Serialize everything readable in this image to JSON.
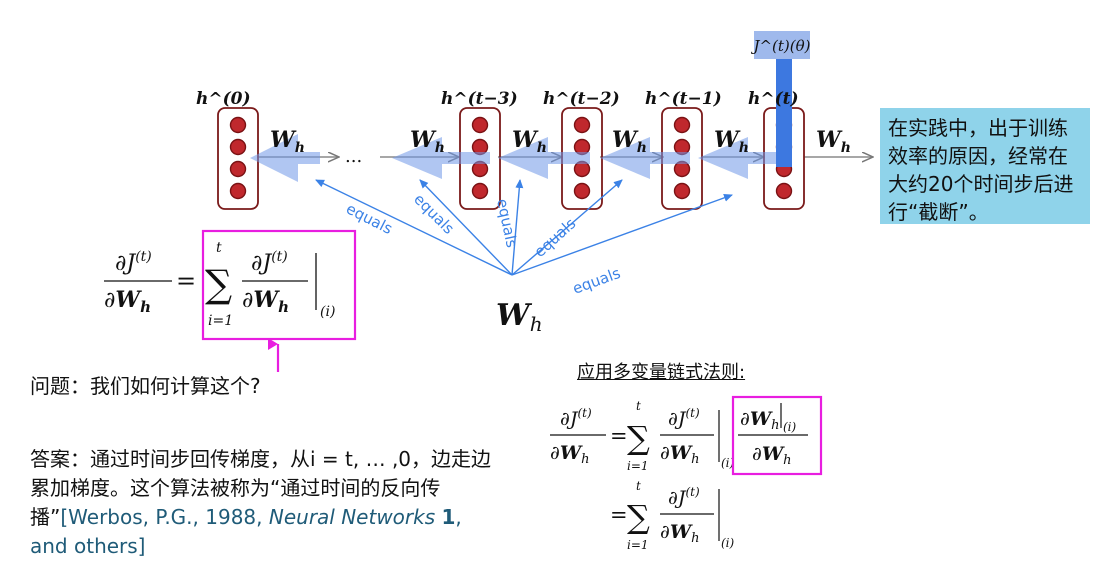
{
  "hidden_labels": [
    "h^(0)",
    "h^(t−3)",
    "h^(t−2)",
    "h^(t−1)",
    "h^(t)"
  ],
  "weight_label": "W",
  "weight_subscript": "h",
  "ellipsis": "...",
  "loss_label": "J^(t)(θ)",
  "equals_label": "equals",
  "equals_count": 5,
  "note_text": "在实践中，出于训练效率的原因，经常在大约20个时间步后进行“截断”。",
  "question": "问题：我们如何计算这个?",
  "answer": "答案：通过时间步回传梯度，从i = t, … ,0，边走边累加梯度。这个算法被称为“通过时间的反向传播”",
  "reference_start": "[Werbos, P.G., 1988, ",
  "reference_journal": "Neural Networks",
  "reference_volume": "1",
  "reference_end": ", and others]",
  "chain_rule_title": "应用多变量链式法则:",
  "colors": {
    "neuron_fill": "#c0282d",
    "neuron_border": "#7a1214",
    "box_border": "#7a1a1a",
    "gradient_arrow": "#6f98e8",
    "gradient_arrow_alpha": 0.55,
    "loss_bar": "#3d78e0",
    "equals_color": "#3b82e6",
    "highlight": "#e81ee0",
    "note_bg": "#8fd3ea",
    "reference_color": "#1f5b78"
  }
}
